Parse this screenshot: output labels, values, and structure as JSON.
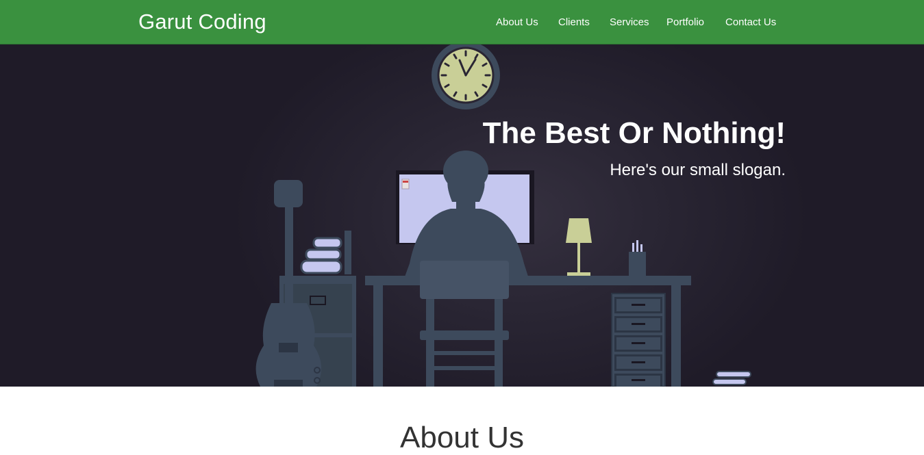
{
  "navbar": {
    "brand": "Garut Coding",
    "background_color": "#3a913f",
    "links": [
      {
        "label": "About Us"
      },
      {
        "label": "Clients"
      },
      {
        "label": "Services"
      },
      {
        "label": "Portfolio"
      },
      {
        "label": "Contact Us"
      }
    ]
  },
  "hero": {
    "title": "The Best Or Nothing!",
    "slogan": "Here's our small slogan.",
    "background_color": "#231f2c",
    "illustration": {
      "icons": [
        "wall-clock-icon",
        "guitar-icon",
        "books-icon",
        "file-cabinet-icon",
        "monitor-icon",
        "person-silhouette-icon",
        "chair-icon",
        "desk-lamp-icon",
        "pen-holder-icon",
        "desk-drawers-icon"
      ],
      "silhouette_color": "#3d4a5c",
      "screen_color": "#c5c7ef",
      "lamp_color": "#c9cf97"
    }
  },
  "about": {
    "heading": "About Us"
  }
}
